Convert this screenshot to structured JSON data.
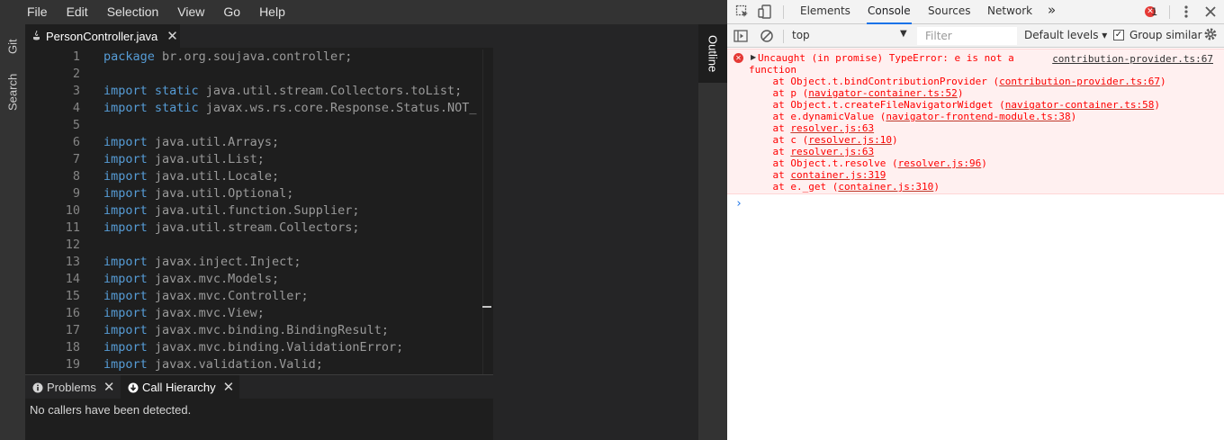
{
  "menu": [
    "File",
    "Edit",
    "Selection",
    "View",
    "Go",
    "Help"
  ],
  "left_bar": {
    "git": "Git",
    "search": "Search"
  },
  "right_bar": {
    "outline": "Outline"
  },
  "editor_tab": {
    "label": "PersonController.java",
    "icon": "java-file-icon",
    "close": "✕"
  },
  "code_lines": [
    {
      "n": "1",
      "kw": "package",
      "rest": " br.org.soujava.controller;"
    },
    {
      "n": "2",
      "kw": "",
      "rest": ""
    },
    {
      "n": "3",
      "kw": "import static",
      "rest": " java.util.stream.Collectors.toList;"
    },
    {
      "n": "4",
      "kw": "import static",
      "rest": " javax.ws.rs.core.Response.Status.NOT_"
    },
    {
      "n": "5",
      "kw": "",
      "rest": ""
    },
    {
      "n": "6",
      "kw": "import",
      "rest": " java.util.Arrays;"
    },
    {
      "n": "7",
      "kw": "import",
      "rest": " java.util.List;"
    },
    {
      "n": "8",
      "kw": "import",
      "rest": " java.util.Locale;"
    },
    {
      "n": "9",
      "kw": "import",
      "rest": " java.util.Optional;"
    },
    {
      "n": "10",
      "kw": "import",
      "rest": " java.util.function.Supplier;"
    },
    {
      "n": "11",
      "kw": "import",
      "rest": " java.util.stream.Collectors;"
    },
    {
      "n": "12",
      "kw": "",
      "rest": ""
    },
    {
      "n": "13",
      "kw": "import",
      "rest": " javax.inject.Inject;"
    },
    {
      "n": "14",
      "kw": "import",
      "rest": " javax.mvc.Models;"
    },
    {
      "n": "15",
      "kw": "import",
      "rest": " javax.mvc.Controller;"
    },
    {
      "n": "16",
      "kw": "import",
      "rest": " javax.mvc.View;"
    },
    {
      "n": "17",
      "kw": "import",
      "rest": " javax.mvc.binding.BindingResult;"
    },
    {
      "n": "18",
      "kw": "import",
      "rest": " javax.mvc.binding.ValidationError;"
    },
    {
      "n": "19",
      "kw": "import",
      "rest": " javax.validation.Valid;"
    }
  ],
  "panel": {
    "problems_label": "Problems",
    "call_hierarchy_label": "Call Hierarchy",
    "close": "✕",
    "message": "No callers have been detected."
  },
  "devtools": {
    "tabs": [
      "Elements",
      "Console",
      "Sources",
      "Network"
    ],
    "active_tab": "Console",
    "more": "»",
    "error_count": "1",
    "context": "top",
    "filter_placeholder": "Filter",
    "levels": "Default levels ▾",
    "group_similar": "Group similar",
    "group_checked": true,
    "error": {
      "line1": "Uncaught (in promise) TypeError: e is not a",
      "line2": "function",
      "source": "contribution-provider.ts:67",
      "stack": [
        {
          "prefix": "    at Object.t.bindContributionProvider (",
          "link": "contribution-provider.ts:67",
          "suffix": ")"
        },
        {
          "prefix": "    at p (",
          "link": "navigator-container.ts:52",
          "suffix": ")"
        },
        {
          "prefix": "    at Object.t.createFileNavigatorWidget (",
          "link": "navigator-container.ts:58",
          "suffix": ")"
        },
        {
          "prefix": "    at e.dynamicValue (",
          "link": "navigator-frontend-module.ts:38",
          "suffix": ")"
        },
        {
          "prefix": "    at ",
          "link": "resolver.js:63",
          "suffix": ""
        },
        {
          "prefix": "    at c (",
          "link": "resolver.js:10",
          "suffix": ")"
        },
        {
          "prefix": "    at ",
          "link": "resolver.js:63",
          "suffix": ""
        },
        {
          "prefix": "    at Object.t.resolve (",
          "link": "resolver.js:96",
          "suffix": ")"
        },
        {
          "prefix": "    at ",
          "link": "container.js:319",
          "suffix": ""
        },
        {
          "prefix": "    at e._get (",
          "link": "container.js:310",
          "suffix": ")"
        }
      ]
    },
    "prompt": "›"
  }
}
